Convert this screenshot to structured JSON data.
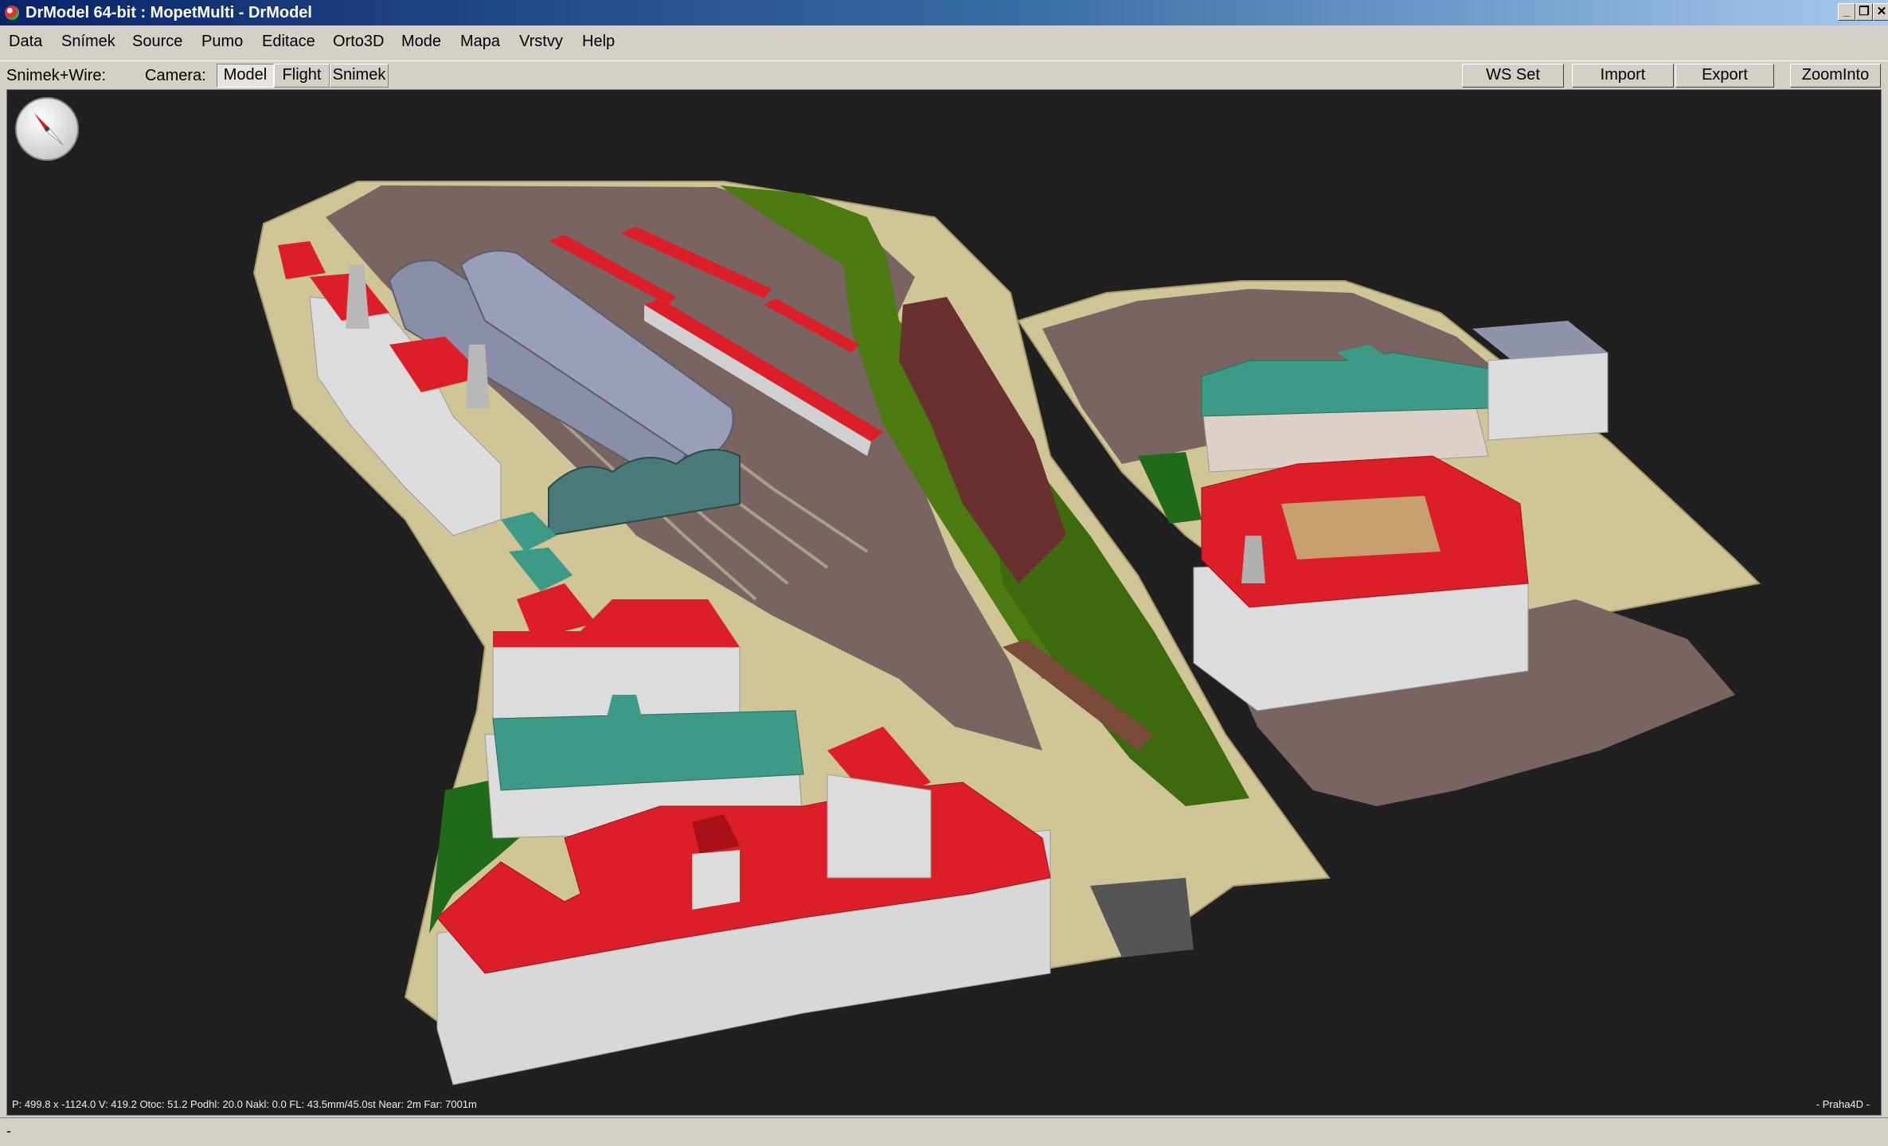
{
  "window": {
    "title": "DrModel 64-bit : MopetMulti - DrModel",
    "min_glyph": "_",
    "max_glyph": "❐",
    "close_glyph": "✕"
  },
  "menu": {
    "items": [
      {
        "label": "Data"
      },
      {
        "label": "Snímek"
      },
      {
        "label": "Source"
      },
      {
        "label": "Pumo"
      },
      {
        "label": "Editace"
      },
      {
        "label": "Orto3D"
      },
      {
        "label": "Mode"
      },
      {
        "label": "Mapa"
      },
      {
        "label": "Vrstvy"
      },
      {
        "label": "Help"
      }
    ]
  },
  "toolbar": {
    "mode_label": "Snimek+Wire:",
    "camera_label": "Camera:",
    "camera_options": [
      {
        "label": "Model",
        "active": true
      },
      {
        "label": "Flight",
        "active": false
      },
      {
        "label": "Snimek",
        "active": false
      }
    ],
    "actions": [
      {
        "label": "WS Set"
      },
      {
        "label": "Import"
      },
      {
        "label": "Export"
      },
      {
        "label": "ZoomInto"
      }
    ]
  },
  "viewport": {
    "status": "P: 499.8 x -1124.0  V: 419.2  Otoc: 51.2  Podhl: 20.0  Nakl: 0.0  FL: 43.5mm/45.0st  Near: 2m  Far: 7001m",
    "brand": "- Praha4D -",
    "icons": {
      "compass": "compass-icon"
    },
    "colors": {
      "background": "#202020",
      "roof": "#dc1e28",
      "wall": "#dcdcdc",
      "ground": "#7a6462",
      "grass": "#4a7a10",
      "paving": "#d2c89a",
      "hall_glass": "#8a8ea8",
      "copper_roof": "#3c9a86"
    }
  },
  "statusbar": {
    "text": "-"
  }
}
